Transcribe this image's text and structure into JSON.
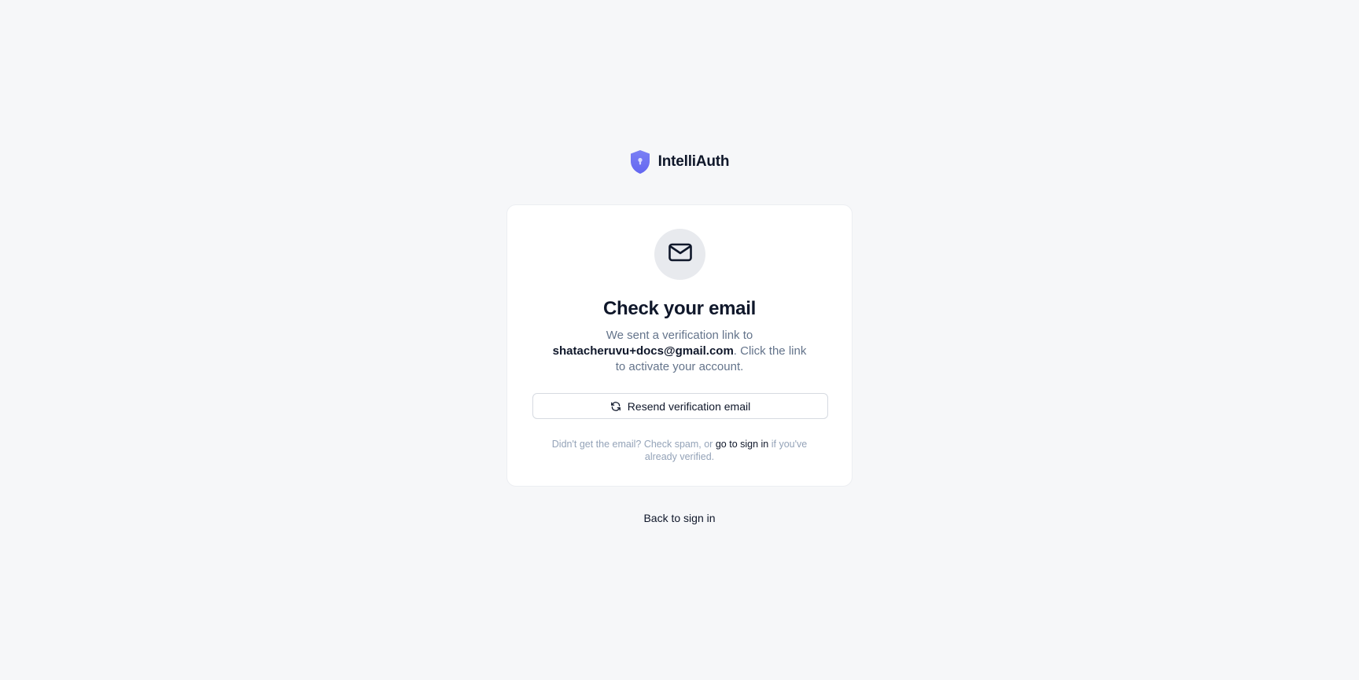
{
  "brand": {
    "name": "IntelliAuth",
    "logo_icon": "shield-keyhole-icon",
    "logo_color": "#6f73f0"
  },
  "card": {
    "icon": "mail-icon",
    "title": "Check your email",
    "message_before": "We sent a verification link to",
    "email": "shatacheruvu+docs@gmail.com",
    "message_after": ". Click the link to activate your account.",
    "resend_button": {
      "icon": "refresh-icon",
      "label": "Resend verification email"
    },
    "help": {
      "before": "Didn't get the email? Check spam, or",
      "link": "go to sign in",
      "after": "if you've already verified."
    }
  },
  "footer": {
    "back_link": "Back to sign in"
  },
  "colors": {
    "background": "#f6f7f9",
    "card": "#ffffff",
    "text_primary": "#0f172a",
    "text_muted": "#64748b",
    "text_faint": "#94a3b8"
  }
}
